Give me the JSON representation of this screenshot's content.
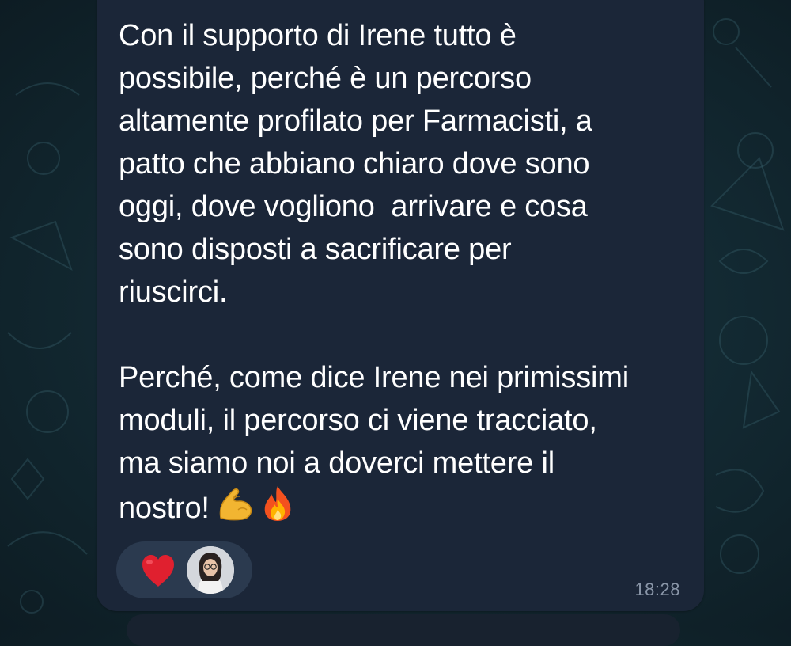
{
  "message": {
    "lines": [
      "Con il supporto di Irene tutto è",
      "possibile, perché è un percorso",
      "altamente profilato per Farmacisti, a",
      "patto che abbiano chiaro dove sono",
      "oggi, dove vogliono  arrivare e cosa",
      "sono disposti a sacrificare per",
      "riuscirci.",
      "",
      "Perché, come dice Irene nei primissimi",
      "moduli, il percorso ci viene tracciato,",
      "ma siamo noi a doverci mettere il",
      "nostro!"
    ],
    "trailing_emojis": [
      "flexed-biceps-icon",
      "fire-icon"
    ],
    "time": "18:28"
  },
  "reactions": [
    {
      "emoji": "heart-icon",
      "reactor": "avatar"
    }
  ],
  "colors": {
    "bubble": "#1b2638",
    "text": "#ffffff",
    "time": "#8a96a8",
    "reaction_pill": "#2b3a4f",
    "heart": "#e0202f",
    "wallpaper": "#132a33"
  }
}
